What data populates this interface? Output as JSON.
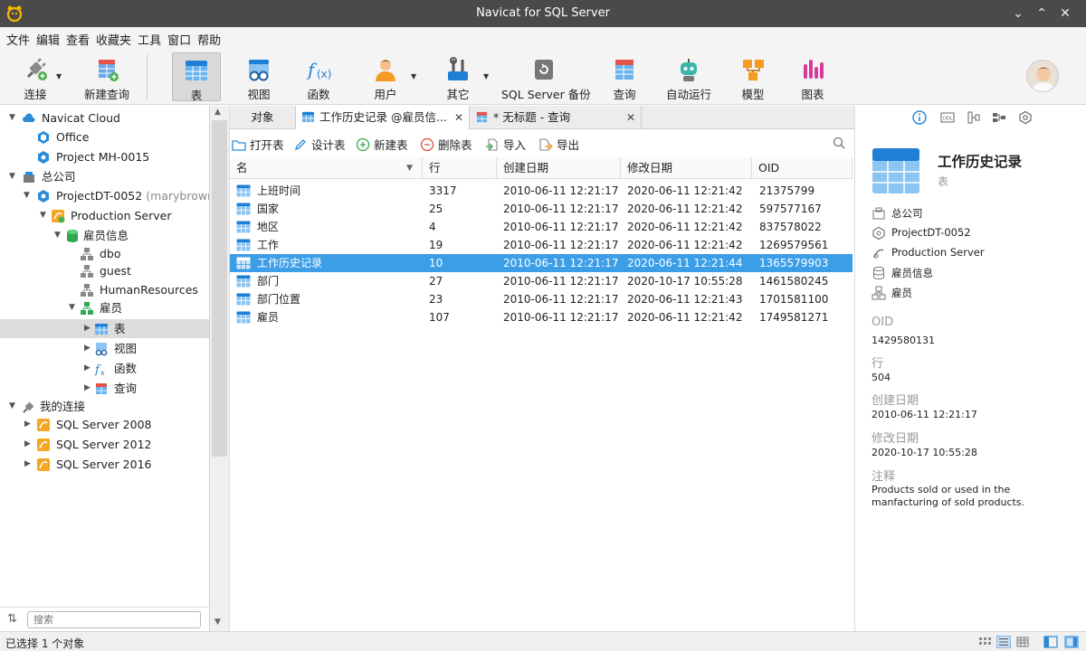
{
  "window": {
    "title": "Navicat for SQL Server"
  },
  "menu": [
    "文件",
    "编辑",
    "查看",
    "收藏夹",
    "工具",
    "窗口",
    "帮助"
  ],
  "toolbar": {
    "connect": "连接",
    "new_query": "新建查询",
    "table": "表",
    "view": "视图",
    "function": "函数",
    "user": "用户",
    "other": "其它",
    "backup": "SQL Server 备份",
    "query": "查询",
    "automation": "自动运行",
    "model": "模型",
    "chart": "图表"
  },
  "sidebar": {
    "tree": [
      {
        "label": "Navicat Cloud"
      },
      {
        "label": "Office"
      },
      {
        "label": "Project MH-0015"
      },
      {
        "label": "总公司"
      },
      {
        "label": "ProjectDT-0052",
        "sub": "(marybrown@"
      },
      {
        "label": "Production Server"
      },
      {
        "label": "雇员信息"
      },
      {
        "label": "dbo"
      },
      {
        "label": "guest"
      },
      {
        "label": "HumanResources"
      },
      {
        "label": "雇员"
      },
      {
        "label": "表"
      },
      {
        "label": "视图"
      },
      {
        "label": "函数"
      },
      {
        "label": "查询"
      },
      {
        "label": "我的连接"
      },
      {
        "label": "SQL Server 2008"
      },
      {
        "label": "SQL Server 2012"
      },
      {
        "label": "SQL Server 2016"
      }
    ],
    "search_placeholder": "搜索"
  },
  "tabs": {
    "objects": "对象",
    "tab1": "工作历史记录 @雇员信...",
    "tab2": "* 无标题 - 查询"
  },
  "obj_toolbar": {
    "open": "打开表",
    "design": "设计表",
    "new": "新建表",
    "delete": "删除表",
    "import": "导入",
    "export": "导出"
  },
  "grid": {
    "headers": [
      "名",
      "行",
      "创建日期",
      "修改日期",
      "OID"
    ],
    "rows": [
      [
        "上班时间",
        "3317",
        "2010-06-11 12:21:17",
        "2020-06-11 12:21:42",
        "21375799"
      ],
      [
        "国家",
        "25",
        "2010-06-11 12:21:17",
        "2020-06-11 12:21:42",
        "597577167"
      ],
      [
        "地区",
        "4",
        "2010-06-11 12:21:17",
        "2020-06-11 12:21:42",
        "837578022"
      ],
      [
        "工作",
        "19",
        "2010-06-11 12:21:17",
        "2020-06-11 12:21:42",
        "1269579561"
      ],
      [
        "工作历史记录",
        "10",
        "2010-06-11 12:21:17",
        "2020-06-11 12:21:44",
        "1365579903"
      ],
      [
        "部门",
        "27",
        "2010-06-11 12:21:17",
        "2020-10-17 10:55:28",
        "1461580245"
      ],
      [
        "部门位置",
        "23",
        "2010-06-11 12:21:17",
        "2020-06-11 12:21:43",
        "1701581100"
      ],
      [
        "雇员",
        "107",
        "2010-06-11 12:21:17",
        "2020-06-11 12:21:42",
        "1749581271"
      ]
    ]
  },
  "info": {
    "name": "工作历史记录",
    "type": "表",
    "path": [
      "总公司",
      "ProjectDT-0052",
      "Production Server",
      "雇员信息",
      "雇员"
    ],
    "oid_label": "OID",
    "oid": "1429580131",
    "rows_label": "行",
    "rows": "504",
    "created_label": "创建日期",
    "created": "2010-06-11 12:21:17",
    "modified_label": "修改日期",
    "modified": "2020-10-17 10:55:28",
    "comment_label": "注释",
    "comment": "Products sold or used in the manfacturing of sold products."
  },
  "status": {
    "text": "已选择 1 个对象"
  },
  "colors": {
    "selection": "#3d9ee8",
    "titlebar": "#4a4a4a",
    "accent_blue": "#2a8ad6"
  }
}
